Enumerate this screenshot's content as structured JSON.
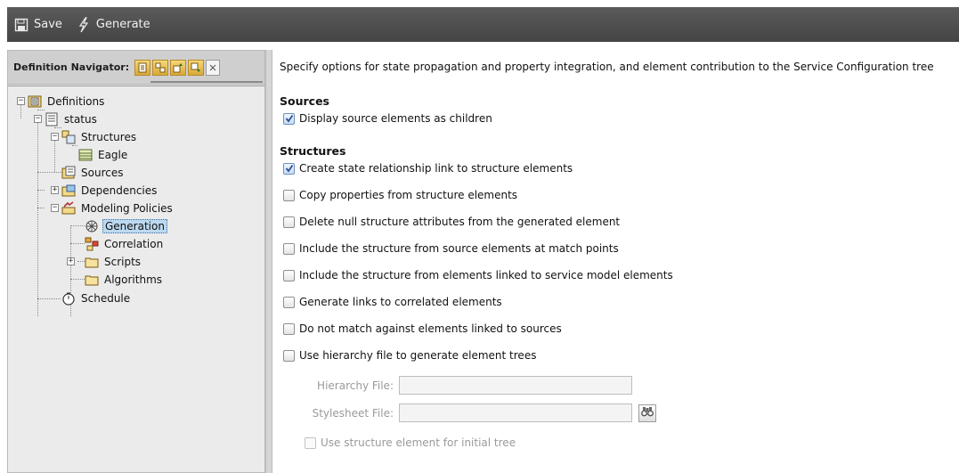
{
  "toolbar": {
    "save_label": "Save",
    "generate_label": "Generate"
  },
  "navigator": {
    "title": "Definition Navigator:",
    "tools": [
      "expand-all-icon",
      "collapse-icon",
      "move-up-icon",
      "move-down-icon",
      "close-icon"
    ]
  },
  "tree": {
    "definitions": "Definitions",
    "status": "status",
    "structures": "Structures",
    "eagle": "Eagle",
    "sources": "Sources",
    "dependencies": "Dependencies",
    "modeling_policies": "Modeling Policies",
    "generation": "Generation",
    "correlation": "Correlation",
    "scripts": "Scripts",
    "algorithms": "Algorithms",
    "schedule": "Schedule"
  },
  "main": {
    "description": "Specify options for state propagation and property integration, and element contribution to the Service Configuration tree",
    "sources_heading": "Sources",
    "sources_options": [
      {
        "label": "Display source elements as children",
        "checked": true
      }
    ],
    "structures_heading": "Structures",
    "structures_options": [
      {
        "label": "Create state relationship link to structure elements",
        "checked": true
      },
      {
        "label": "Copy properties from structure elements",
        "checked": false
      },
      {
        "label": "Delete null structure attributes from the generated element",
        "checked": false
      },
      {
        "label": "Include the structure from source elements at match points",
        "checked": false
      },
      {
        "label": "Include the structure from elements linked to service model elements",
        "checked": false
      },
      {
        "label": "Generate links to correlated elements",
        "checked": false
      },
      {
        "label": "Do not match against elements linked to sources",
        "checked": false
      },
      {
        "label": "Use hierarchy file to generate element trees",
        "checked": false
      }
    ],
    "hierarchy_file_label": "Hierarchy File:",
    "hierarchy_file_value": "",
    "stylesheet_file_label": "Stylesheet File:",
    "stylesheet_file_value": "",
    "initial_tree_label": "Use structure element for initial tree",
    "initial_tree_checked": false
  },
  "colors": {
    "toolbar_bg": "#4f4f4f",
    "selection": "#bcd9f0",
    "checkmark": "#2a4f8f"
  }
}
